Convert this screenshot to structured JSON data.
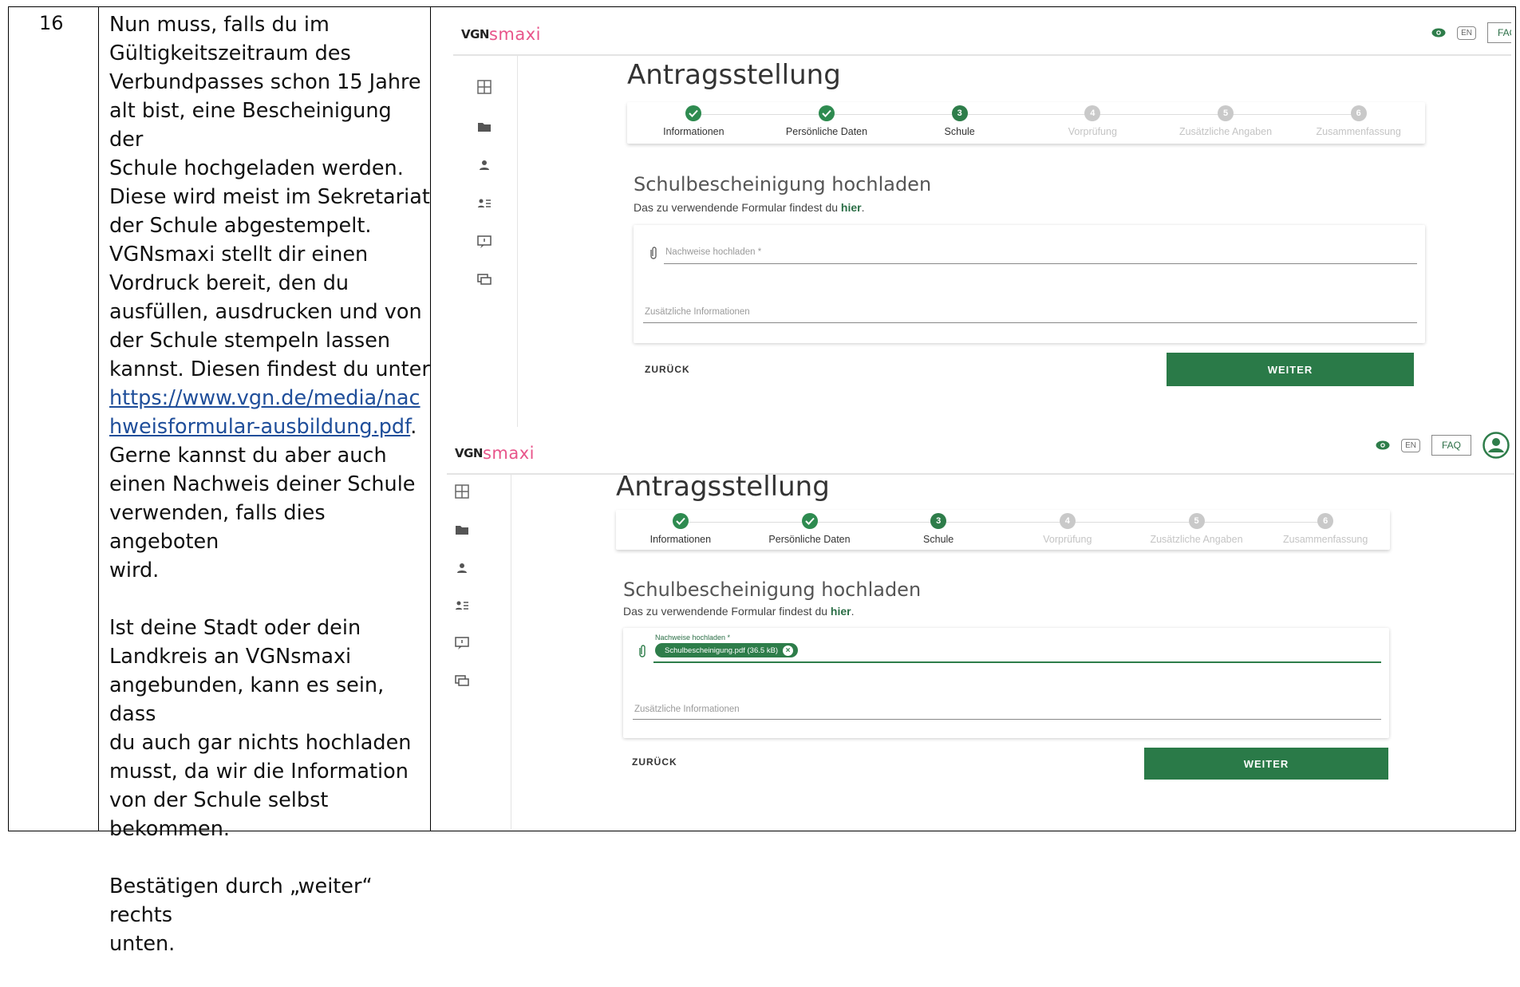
{
  "row": {
    "step_number": "16",
    "paragraph1_lines": [
      "Nun muss, falls du im",
      "Gültigkeitszeitraum des",
      "Verbundpasses schon 15 Jahre",
      "alt bist, eine Bescheinigung der",
      "Schule hochgeladen werden.",
      "Diese wird meist im Sekretariat",
      "der Schule abgestempelt.",
      "VGNsmaxi stellt dir einen",
      "Vordruck bereit, den du",
      "ausfüllen, ausdrucken und von",
      "der Schule stempeln lassen",
      "kannst. Diesen findest du unter"
    ],
    "link_text": "https://www.vgn.de/media/nachweisformular-ausbildung.pdf",
    "link_suffix": ".",
    "paragraph1_tail_lines": [
      "Gerne kannst du aber auch",
      "einen Nachweis deiner Schule",
      "verwenden, falls dies angeboten",
      "wird."
    ],
    "paragraph2_lines": [
      "Ist deine Stadt oder dein",
      "Landkreis an VGNsmaxi",
      "angebunden, kann es sein, dass",
      "du auch gar nichts hochladen",
      "musst, da wir die Information",
      "von der Schule selbst",
      "bekommen."
    ],
    "paragraph3_lines": [
      "Bestätigen durch „weiter“ rechts",
      "unten."
    ]
  },
  "app": {
    "logo_prefix": "VGN",
    "logo_suffix": "smaxi",
    "lang_button": "EN",
    "faq_button": "FAQ",
    "page_title": "Antragsstellung",
    "steps": [
      {
        "label": "Informationen",
        "state": "done",
        "num": ""
      },
      {
        "label": "Persönliche Daten",
        "state": "done",
        "num": ""
      },
      {
        "label": "Schule",
        "state": "active",
        "num": "3"
      },
      {
        "label": "Vorprüfung",
        "state": "todo",
        "num": "4"
      },
      {
        "label": "Zusätzliche Angaben",
        "state": "todo",
        "num": "5"
      },
      {
        "label": "Zusammenfassung",
        "state": "todo",
        "num": "6"
      }
    ],
    "section_title": "Schulbescheinigung hochladen",
    "section_sub": "Das zu verwendende Formular findest du ",
    "section_link": "hier",
    "section_sub_end": ".",
    "upload_placeholder": "Nachweise hochladen *",
    "upload_label_small": "Nachweise hochladen *",
    "uploaded_file": "Schulbescheinigung.pdf (36.5 kB)",
    "extra_placeholder": "Zusätzliche Informationen",
    "back_button": "ZURÜCK",
    "next_button": "WEITER"
  },
  "colors": {
    "brand_green": "#2a7a48",
    "smaxi_pink": "#e8548a"
  }
}
